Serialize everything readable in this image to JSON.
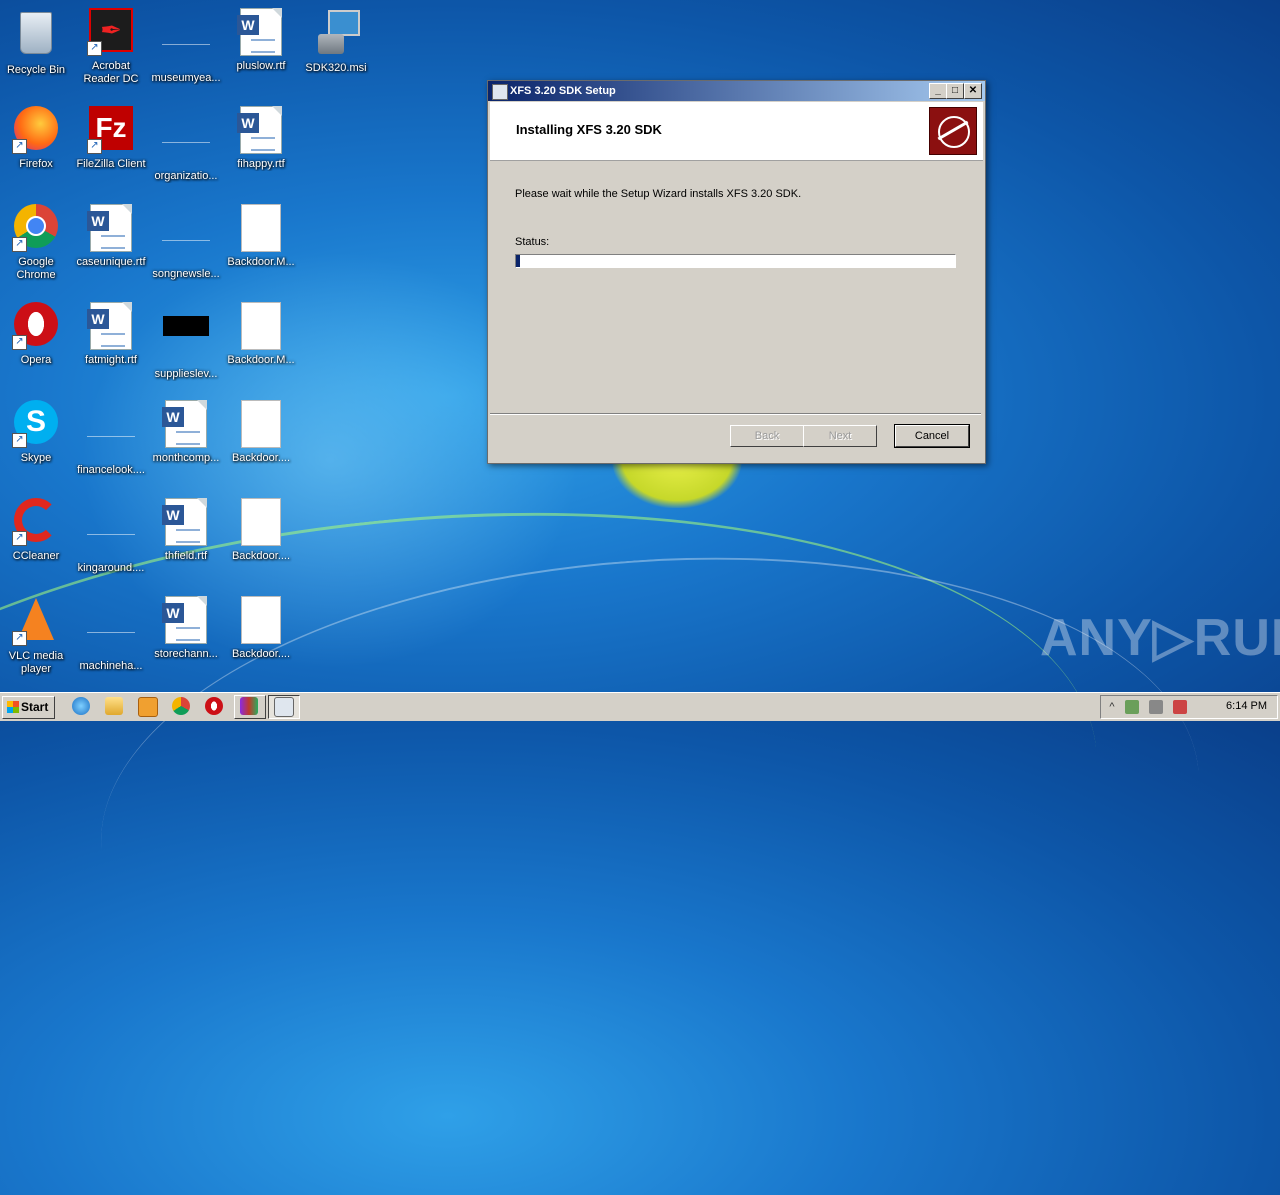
{
  "desktop": {
    "icons": [
      {
        "label": "Recycle Bin"
      },
      {
        "label": "Acrobat Reader DC"
      },
      {
        "label": "museumyea..."
      },
      {
        "label": "pluslow.rtf"
      },
      {
        "label": "SDK320.msi"
      },
      {
        "label": "Firefox"
      },
      {
        "label": "FileZilla Client"
      },
      {
        "label": "organizatio..."
      },
      {
        "label": "fihappy.rtf"
      },
      {
        "label": "Google Chrome"
      },
      {
        "label": "caseunique.rtf"
      },
      {
        "label": "songnewsle..."
      },
      {
        "label": "Backdoor.M..."
      },
      {
        "label": "Opera"
      },
      {
        "label": "fatmight.rtf"
      },
      {
        "label": "supplieslev..."
      },
      {
        "label": "Backdoor.M..."
      },
      {
        "label": "Skype"
      },
      {
        "label": "financelook...."
      },
      {
        "label": "monthcomp..."
      },
      {
        "label": "Backdoor...."
      },
      {
        "label": "CCleaner"
      },
      {
        "label": "kingaround...."
      },
      {
        "label": "thfield.rtf"
      },
      {
        "label": "Backdoor...."
      },
      {
        "label": "VLC media player"
      },
      {
        "label": "machineha..."
      },
      {
        "label": "storechann..."
      },
      {
        "label": "Backdoor...."
      }
    ]
  },
  "dialog": {
    "title": "XFS 3.20 SDK Setup",
    "header_title": "Installing XFS 3.20 SDK",
    "message": "Please wait while the Setup Wizard installs XFS 3.20 SDK.",
    "status_label": "Status:",
    "progress_fraction": 0.004,
    "minimize_glyph": "_",
    "maximize_glyph": "□",
    "close_glyph": "✕",
    "buttons": {
      "back": "Back",
      "next": "Next",
      "cancel": "Cancel"
    }
  },
  "watermark": "ANY▷RUN",
  "taskbar": {
    "start_label": "Start",
    "clock": "6:14 PM",
    "tray_glyph": "^"
  },
  "colors": {
    "title_gradient_start": "#0a246a",
    "dialog_bg": "#d4d0c8",
    "logo_red": "#8b1010"
  }
}
